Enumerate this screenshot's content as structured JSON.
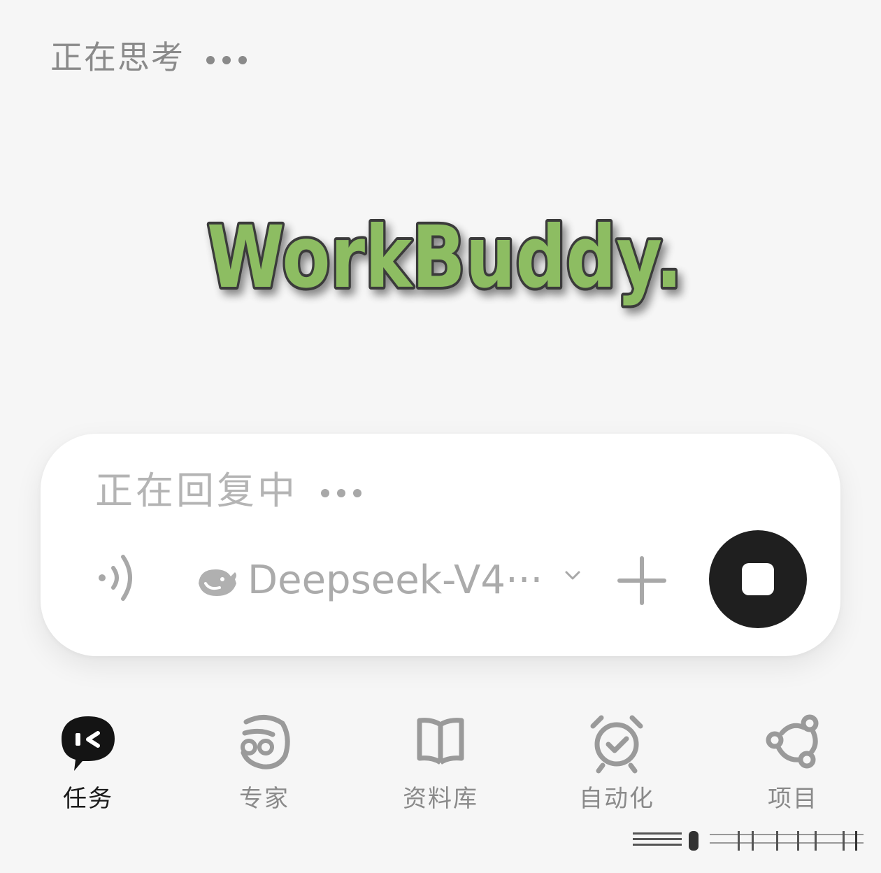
{
  "status": {
    "thinking_text": "正在思考"
  },
  "brand": {
    "logo_text": "WorkBuddy.",
    "fill_color": "#8dbd62",
    "outline_color": "#3a3a3a"
  },
  "composer": {
    "placeholder": "正在回复中",
    "model": {
      "label": "Deepseek-V4···",
      "icon": "deepseek-whale-icon"
    },
    "voice_icon": "voice-wave-icon",
    "add_icon": "plus-icon",
    "stop_icon": "stop-icon"
  },
  "tabs": [
    {
      "label": "任务",
      "icon": "task-chat-icon",
      "active": true
    },
    {
      "label": "专家",
      "icon": "expert-icon",
      "active": false
    },
    {
      "label": "资料库",
      "icon": "book-icon",
      "active": false
    },
    {
      "label": "自动化",
      "icon": "alarm-clock-check-icon",
      "active": false
    },
    {
      "label": "项目",
      "icon": "project-nodes-icon",
      "active": false
    }
  ],
  "colors": {
    "background": "#f6f6f6",
    "accent_dark": "#1f1f1f",
    "muted_text": "#8a8a8a",
    "placeholder_text": "#b4b4b4",
    "icon_gray": "#9a9a9a"
  }
}
